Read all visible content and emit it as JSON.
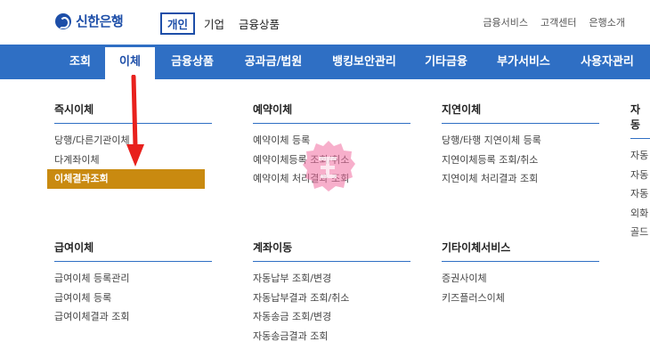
{
  "brand": {
    "name": "신한은행"
  },
  "top_tabs": [
    {
      "label": "개인",
      "active": true
    },
    {
      "label": "기업",
      "active": false
    },
    {
      "label": "금융상품",
      "active": false
    }
  ],
  "utils": [
    "금융서비스",
    "고객센터",
    "은행소개"
  ],
  "nav": [
    {
      "label": "조회",
      "active": false
    },
    {
      "label": "이체",
      "active": true
    },
    {
      "label": "금융상품",
      "active": false
    },
    {
      "label": "공과금/법원",
      "active": false
    },
    {
      "label": "뱅킹보안관리",
      "active": false
    },
    {
      "label": "기타금융",
      "active": false
    },
    {
      "label": "부가서비스",
      "active": false
    },
    {
      "label": "사용자관리",
      "active": false
    }
  ],
  "menu": {
    "immediate": {
      "title": "즉시이체",
      "items": [
        "당행/다른기관이체",
        "다계좌이체",
        "이체결과조회"
      ],
      "highlighted": "이체결과조회"
    },
    "scheduled": {
      "title": "예약이체",
      "items": [
        "예약이체 등록",
        "예약이체등록 조회/취소",
        "예약이체 처리결과 조회"
      ]
    },
    "delayed": {
      "title": "지연이체",
      "items": [
        "당행/타행 지연이체 등록",
        "지연이체등록 조회/취소",
        "지연이체 처리결과 조회"
      ]
    },
    "auto": {
      "title": "자동",
      "items": [
        "자동",
        "자동",
        "자동",
        "외화",
        "골드"
      ]
    },
    "salary": {
      "title": "급여이체",
      "items": [
        "급여이체 등록관리",
        "급여이체 등록",
        "급여이체결과 조회"
      ]
    },
    "account_move": {
      "title": "계좌이동",
      "items": [
        "자동납부 조회/변경",
        "자동납부결과 조회/취소",
        "자동송금 조회/변경",
        "자동송금결과 조회"
      ]
    },
    "other": {
      "title": "기타이체서비스",
      "items": [
        "증권사이체",
        "키즈플러스이체"
      ]
    }
  },
  "colors": {
    "brand": "#1d4ea8",
    "nav": "#2f6fc4",
    "highlight": "#c98a10",
    "annotation": "#e8211d"
  },
  "icons": {
    "logo": "shinhan-logo-icon",
    "arrow": "red-arrow-annotation",
    "stamp": "pink-stamp-watermark"
  }
}
